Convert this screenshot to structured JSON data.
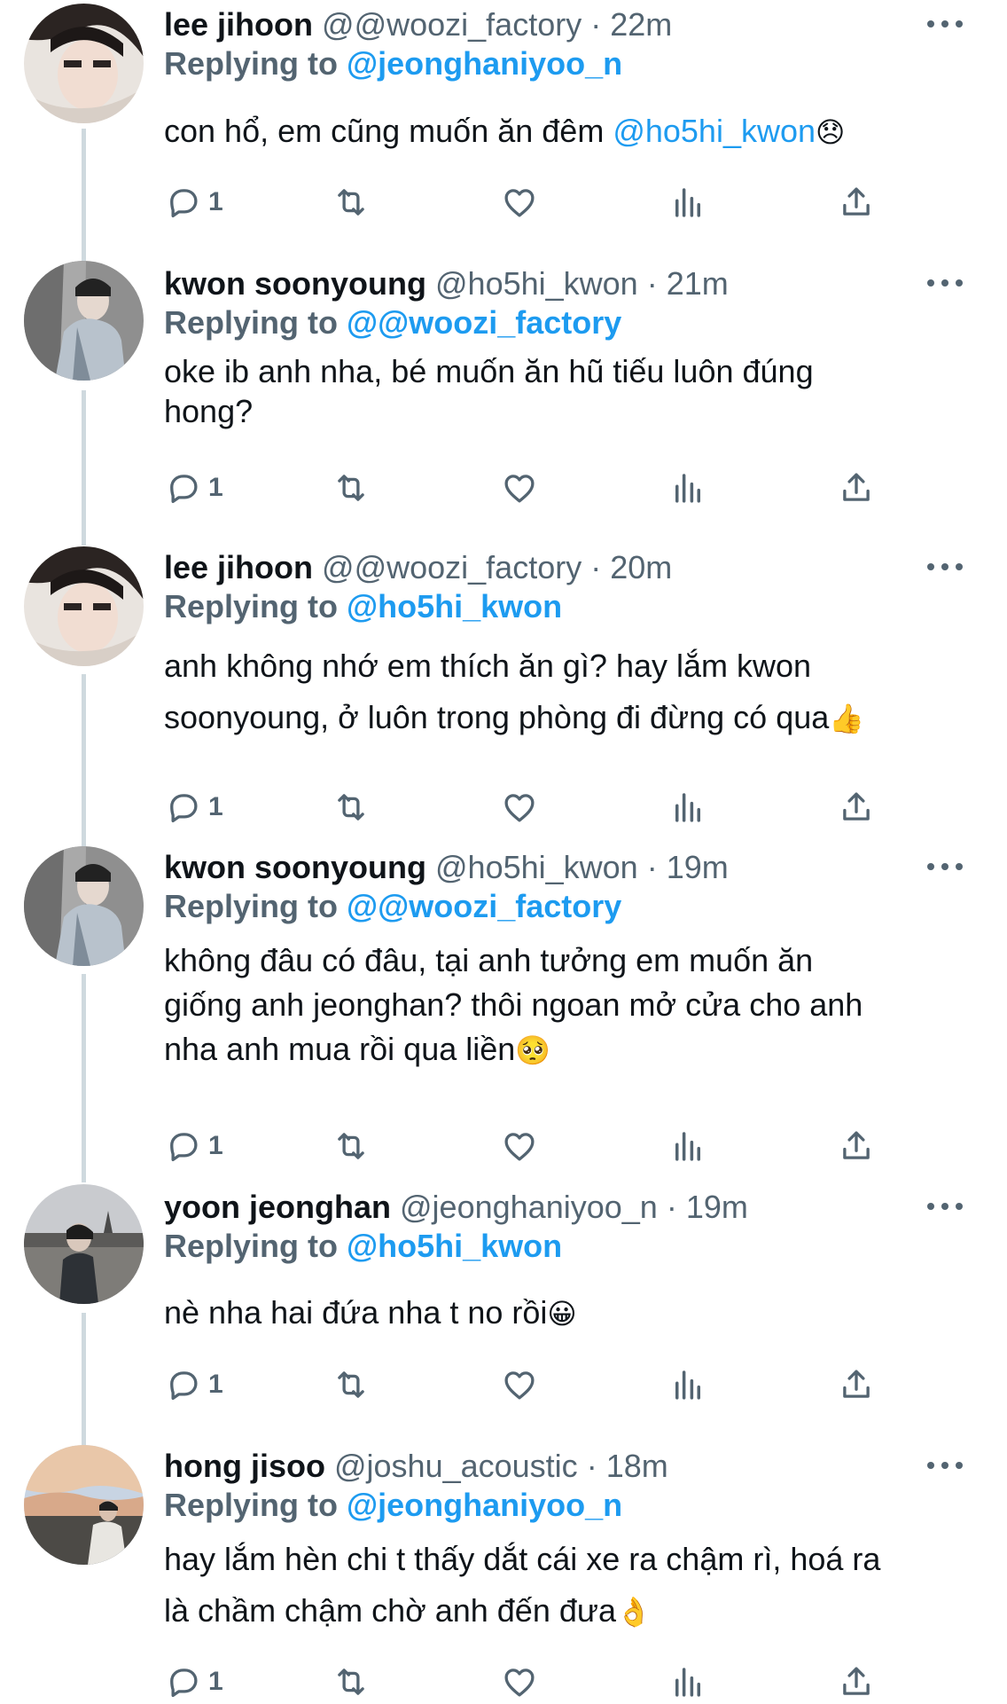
{
  "tweets": [
    {
      "name": "lee jihoon",
      "handle": "@@woozi_factory",
      "time": "22m",
      "reply_label": "Replying to",
      "reply_to": "@jeonghaniyoo_n",
      "text": "con hổ, em cũng muốn ăn đêm ",
      "text_mention": "@ho5hi_kwon",
      "emoji": "😞",
      "reply_count": "1",
      "avatar": "avatar-lee-jihoon"
    },
    {
      "name": "kwon soonyoung",
      "handle": "@ho5hi_kwon",
      "time": "21m",
      "reply_label": "Replying to",
      "reply_to": "@@woozi_factory",
      "text_line1": "oke ib anh nha, bé muốn ăn hũ tiếu luôn đúng",
      "text_line2": "hong?",
      "reply_count": "1",
      "avatar": "avatar-kwon-soonyoung"
    },
    {
      "name": "lee jihoon",
      "handle": "@@woozi_factory",
      "time": "20m",
      "reply_label": "Replying to",
      "reply_to": "@ho5hi_kwon",
      "text_line1": "anh không nhớ em thích ăn gì? hay lắm kwon",
      "text_line2": "soonyoung, ở luôn trong phòng đi đừng có qua",
      "emoji": "👍",
      "reply_count": "1",
      "avatar": "avatar-lee-jihoon"
    },
    {
      "name": "kwon soonyoung",
      "handle": "@ho5hi_kwon",
      "time": "19m",
      "reply_label": "Replying to",
      "reply_to": "@@woozi_factory",
      "text_line1": "không đâu có đâu, tại anh tưởng em muốn ăn",
      "text_line2": "giống anh jeonghan? thôi ngoan mở cửa cho anh",
      "text_line3": "nha anh mua rồi qua liền",
      "emoji": "🥺",
      "reply_count": "1",
      "avatar": "avatar-kwon-soonyoung"
    },
    {
      "name": "yoon jeonghan",
      "handle": "@jeonghaniyoo_n",
      "time": "19m",
      "reply_label": "Replying to",
      "reply_to": "@ho5hi_kwon",
      "text": "nè nha hai đứa nha t no rồi",
      "emoji": "😀",
      "reply_count": "1",
      "avatar": "avatar-yoon-jeonghan"
    },
    {
      "name": "hong jisoo",
      "handle": "@joshu_acoustic",
      "time": "18m",
      "reply_label": "Replying to",
      "reply_to": "@jeonghaniyoo_n",
      "text_line1": "hay lắm hèn chi t thấy dắt cái xe ra chậm rì, hoá ra",
      "text_line2": "là chầm chậm chờ anh đến đưa",
      "emoji": "👌",
      "reply_count": "1",
      "avatar": "avatar-hong-jisoo"
    }
  ],
  "separator": "·",
  "colors": {
    "link": "#1d9bf0",
    "secondary": "#536471",
    "primary": "#0f1419",
    "thread_line": "#cfd9de"
  },
  "icons": [
    "reply-icon",
    "retweet-icon",
    "like-icon",
    "analytics-icon",
    "share-icon",
    "more-icon"
  ]
}
